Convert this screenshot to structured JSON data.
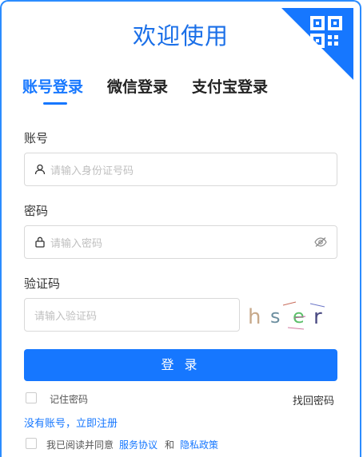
{
  "header": {
    "title": "欢迎使用"
  },
  "tabs": [
    {
      "label": "账号登录",
      "active": true
    },
    {
      "label": "微信登录",
      "active": false
    },
    {
      "label": "支付宝登录",
      "active": false
    }
  ],
  "account": {
    "label": "账号",
    "placeholder": "请输入身份证号码"
  },
  "password": {
    "label": "密码",
    "placeholder": "请输入密码"
  },
  "captcha": {
    "label": "验证码",
    "placeholder": "请输入验证码",
    "code": "hser"
  },
  "login_button": "登 录",
  "remember": "记住密码",
  "forgot": "找回密码",
  "register": "没有账号，立即注册",
  "agreement": {
    "prefix": "我已阅读并同意",
    "service": "服务协议",
    "and": "和",
    "privacy": "隐私政策"
  },
  "colors": {
    "accent": "#1677ff",
    "title": "#1a6fe8"
  }
}
